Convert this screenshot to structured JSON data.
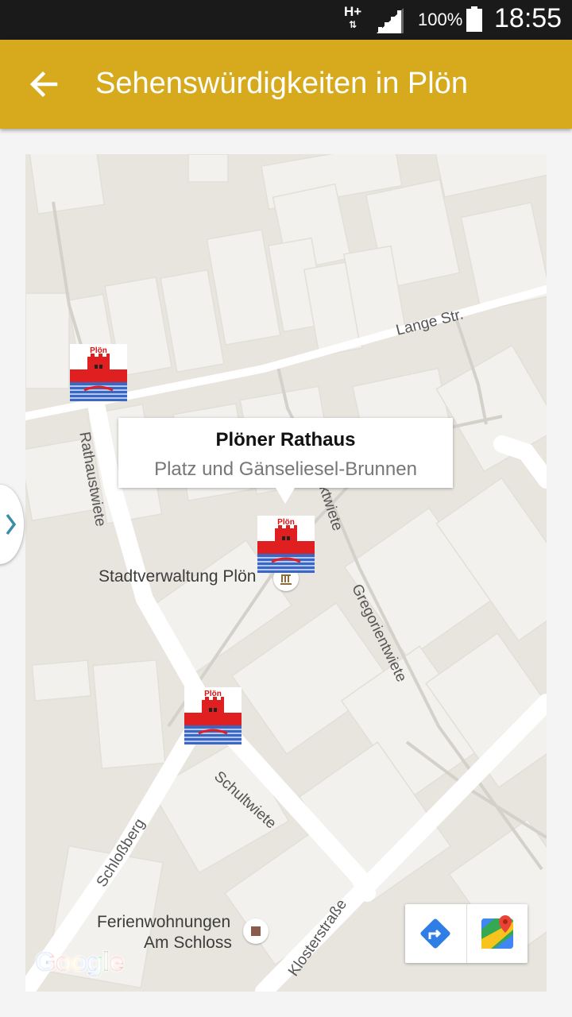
{
  "status_bar": {
    "network": "H+",
    "battery_percent": "100%",
    "time": "18:55"
  },
  "app_bar": {
    "title": "Sehenswürdigkeiten in Plön"
  },
  "map": {
    "streets": [
      "Lange Str.",
      "Rathaustwiete",
      "ktwiete",
      "Gregorientwiete",
      "Schultwiete",
      "Schloßberg",
      "Klosterstraße"
    ],
    "pois": [
      "Stadtverwaltung Plön",
      "Ferienwohnungen",
      "Am Schloss"
    ],
    "marker_text": "Plön",
    "info_window": {
      "title": "Plöner Rathaus",
      "subtitle": "Platz und Gänseliesel-Brunnen"
    },
    "logo": "Google",
    "toolbar": [
      "directions-icon",
      "google-maps-icon"
    ]
  },
  "colors": {
    "app_bar": "#d6aa1c",
    "status_bar": "#1a1a1a",
    "map_bg": "#e8e5df",
    "building": "#f3f1ed",
    "road": "#ffffff"
  }
}
